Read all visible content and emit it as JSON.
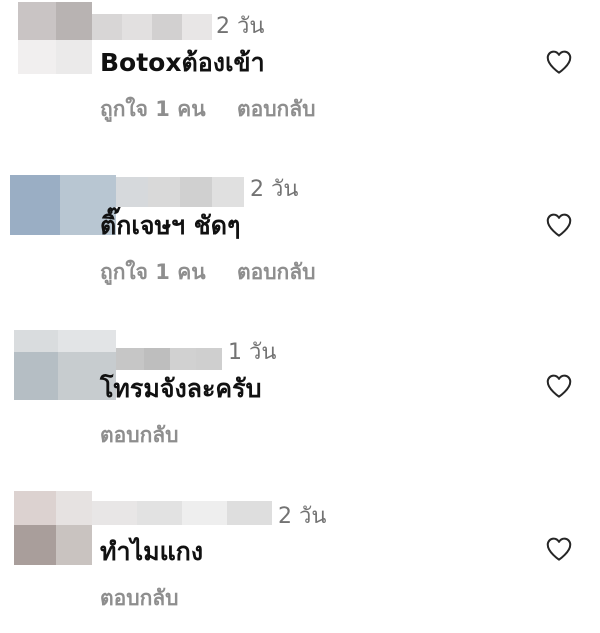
{
  "comments": [
    {
      "time": "2 วัน",
      "text": "Botoxต้องเข้า",
      "likes": "ถูกใจ 1 คน",
      "reply": "ตอบกลับ",
      "avatar_colors": [
        "#c9c4c4",
        "#b8b3b2",
        "#f1efef",
        "#ebeaea"
      ],
      "name_colors": [
        "#d8d6d6",
        "#e2e0e0",
        "#d2d0d0",
        "#e8e6e6"
      ]
    },
    {
      "time": "2 วัน",
      "text": "ติ๊กเจษฯ ชัดๆ",
      "likes": "ถูกใจ 1 คน",
      "reply": "ตอบกลับ",
      "avatar_colors": [
        "#9aaec4",
        "#b8c6d2",
        "#a6b8cc",
        "#c6d0da"
      ],
      "name_colors": [
        "#d6d9dc",
        "#d9d9d9",
        "#d0d0d0",
        "#e0e0e0"
      ]
    },
    {
      "time": "1 วัน",
      "text": "โทรมจังละครับ",
      "likes": "",
      "reply": "ตอบกลับ",
      "avatar_colors": [
        "#d9dcde",
        "#c2c8cc",
        "#b5bec4",
        "#c7cccf"
      ],
      "name_colors": [
        "#c6c6c6",
        "#bebebe",
        "#d1d1d1",
        "#cfcfcf"
      ]
    },
    {
      "time": "2 วัน",
      "text": "ทำไมแกง",
      "likes": "",
      "reply": "ตอบกลับ",
      "avatar_colors": [
        "#dcd2d0",
        "#d8d2d1",
        "#a99e9b",
        "#c9c3c0"
      ],
      "name_colors": [
        "#e8e6e6",
        "#e2e2e2",
        "#eeeeee",
        "#dedede"
      ]
    }
  ],
  "colors": {
    "time": "#737373",
    "text": "#111111",
    "action": "#8e8e8e",
    "heart": "#262626"
  },
  "icons": {
    "like": "heart-outline-icon"
  }
}
